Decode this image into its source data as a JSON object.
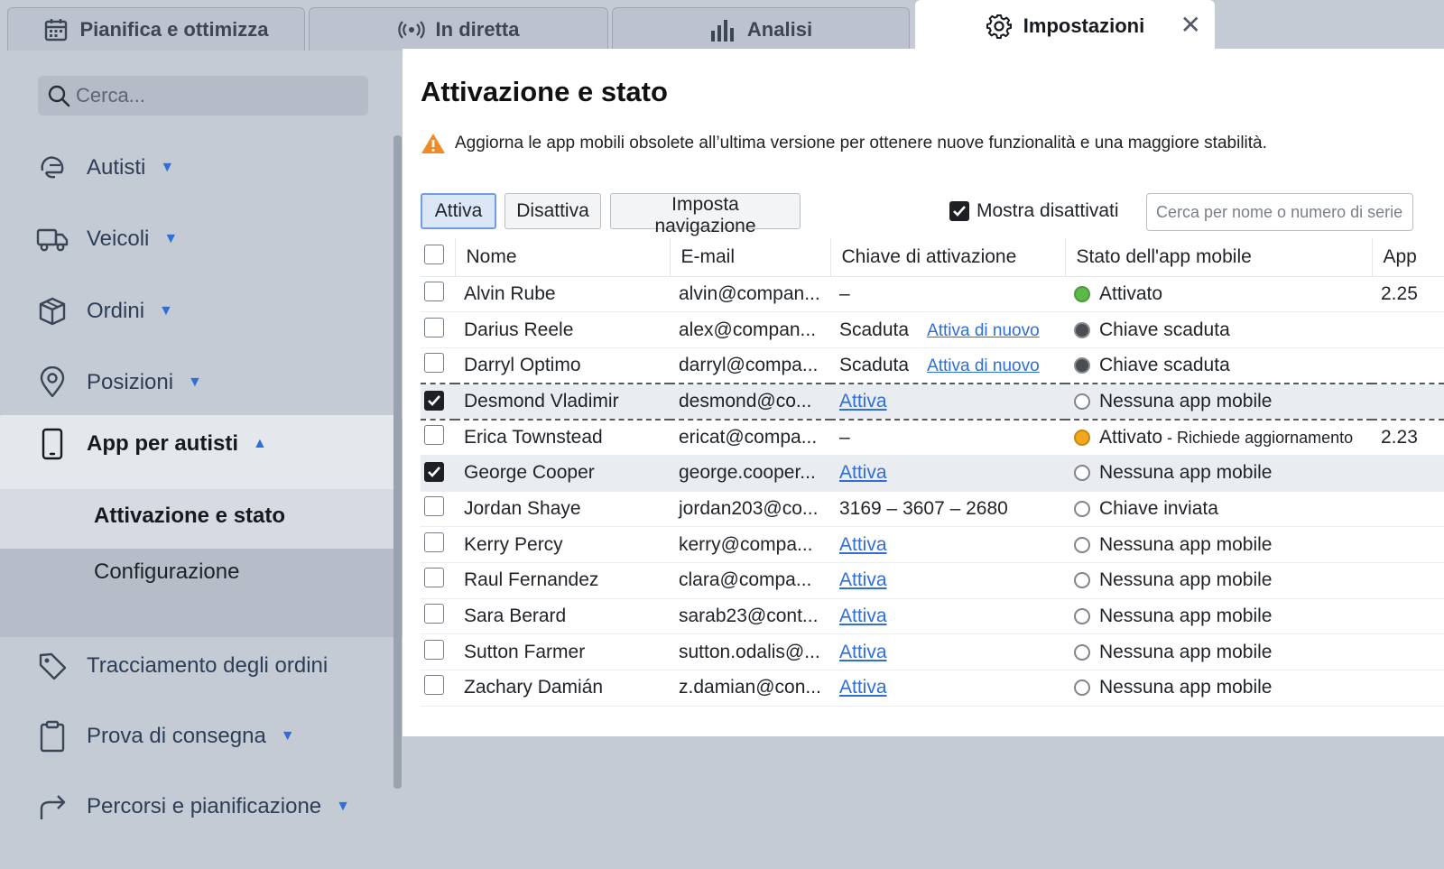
{
  "tabs": [
    {
      "label": "Pianifica e ottimizza",
      "icon": "calendar-icon"
    },
    {
      "label": "In diretta",
      "icon": "broadcast-icon"
    },
    {
      "label": "Analisi",
      "icon": "bar-chart-icon"
    },
    {
      "label": "Impostazioni",
      "icon": "gear-icon",
      "active": true
    }
  ],
  "sidebar": {
    "search_placeholder": "Cerca...",
    "items": [
      {
        "label": "Autisti",
        "icon": "helmet-icon"
      },
      {
        "label": "Veicoli",
        "icon": "truck-icon"
      },
      {
        "label": "Ordini",
        "icon": "box-icon"
      },
      {
        "label": "Posizioni",
        "icon": "location-pin-icon"
      },
      {
        "label": "App per autisti",
        "icon": "phone-icon",
        "expanded": true
      },
      {
        "label": "Tracciamento degli ordini",
        "icon": "tag-icon"
      },
      {
        "label": "Prova di consegna",
        "icon": "clipboard-icon"
      },
      {
        "label": "Percorsi e pianificazione",
        "icon": "route-arrow-icon"
      }
    ],
    "subitems": [
      "Attivazione e stato",
      "Configurazione"
    ]
  },
  "main": {
    "title": "Attivazione e stato",
    "notice": "Aggiorna le app mobili obsolete all’ultima versione per ottenere nuove funzionalità e una maggiore stabilità.",
    "toolbar": {
      "activate": "Attiva",
      "deactivate": "Disattiva",
      "navigation": "Imposta navigazione",
      "show_disabled": "Mostra disattivati",
      "show_disabled_checked": true,
      "search_placeholder": "Cerca per nome o numero di serie"
    },
    "columns": [
      "Nome",
      "E-mail",
      "Chiave di attivazione",
      "Stato dell'app mobile",
      "App"
    ],
    "rows": [
      {
        "name": "Alvin Rube",
        "email": "alvin@compan...",
        "key": "–",
        "key_link": false,
        "reactivate": "",
        "status": "Attivato",
        "status_sub": "",
        "dot": "green",
        "app": "2.25",
        "checked": false
      },
      {
        "name": "Darius Reele",
        "email": "alex@compan...",
        "key": "Scaduta",
        "key_link": false,
        "reactivate": "Attiva di nuovo",
        "status": "Chiave scaduta",
        "status_sub": "",
        "dot": "dark",
        "app": "",
        "checked": false
      },
      {
        "name": "Darryl Optimo",
        "email": "darryl@compa...",
        "key": "Scaduta",
        "key_link": false,
        "reactivate": "Attiva di nuovo",
        "status": "Chiave scaduta",
        "status_sub": "",
        "dot": "dark",
        "app": "",
        "checked": false
      },
      {
        "name": "Desmond Vladimir",
        "email": "desmond@co...",
        "key": "Attiva",
        "key_link": true,
        "reactivate": "",
        "status": "Nessuna app mobile",
        "status_sub": "",
        "dot": "empty",
        "app": "",
        "checked": true,
        "focused": true
      },
      {
        "name": "Erica Townstead",
        "email": "ericat@compa...",
        "key": "–",
        "key_link": false,
        "reactivate": "",
        "status": "Attivato",
        "status_sub": " - Richiede aggiornamento",
        "dot": "orange",
        "app": "2.23",
        "checked": false
      },
      {
        "name": "George Cooper",
        "email": "george.cooper...",
        "key": "Attiva",
        "key_link": true,
        "reactivate": "",
        "status": "Nessuna app mobile",
        "status_sub": "",
        "dot": "empty",
        "app": "",
        "checked": true
      },
      {
        "name": "Jordan Shaye",
        "email": "jordan203@co...",
        "key": "3169 – 3607 – 2680",
        "key_link": false,
        "reactivate": "",
        "status": "Chiave inviata",
        "status_sub": "",
        "dot": "empty",
        "app": "",
        "checked": false
      },
      {
        "name": "Kerry Percy",
        "email": "kerry@compa...",
        "key": "Attiva",
        "key_link": true,
        "reactivate": "",
        "status": "Nessuna app mobile",
        "status_sub": "",
        "dot": "empty",
        "app": "",
        "checked": false
      },
      {
        "name": "Raul Fernandez",
        "email": "clara@compa...",
        "key": "Attiva",
        "key_link": true,
        "reactivate": "",
        "status": "Nessuna app mobile",
        "status_sub": "",
        "dot": "empty",
        "app": "",
        "checked": false
      },
      {
        "name": "Sara Berard",
        "email": "sarab23@cont...",
        "key": "Attiva",
        "key_link": true,
        "reactivate": "",
        "status": "Nessuna app mobile",
        "status_sub": "",
        "dot": "empty",
        "app": "",
        "checked": false
      },
      {
        "name": "Sutton Farmer",
        "email": "sutton.odalis@...",
        "key": "Attiva",
        "key_link": true,
        "reactivate": "",
        "status": "Nessuna app mobile",
        "status_sub": "",
        "dot": "empty",
        "app": "",
        "checked": false
      },
      {
        "name": "Zachary Damián",
        "email": "z.damian@con...",
        "key": "Attiva",
        "key_link": true,
        "reactivate": "",
        "status": "Nessuna app mobile",
        "status_sub": "",
        "dot": "empty",
        "app": "",
        "checked": false
      }
    ]
  },
  "colors": {
    "accent": "#2f6fd6",
    "warning": "#f08a24",
    "active_green": "#5db84a",
    "update_orange": "#f2a81d"
  }
}
